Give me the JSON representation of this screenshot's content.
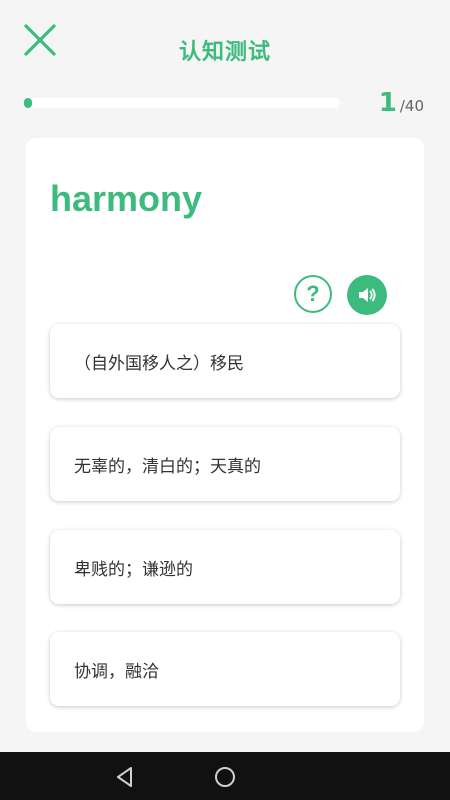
{
  "header": {
    "title": "认知测试",
    "close_icon": "close-icon"
  },
  "progress": {
    "current": "1",
    "total": "/40",
    "fraction": 0.025
  },
  "question": {
    "word": "harmony",
    "help_label": "?",
    "help_icon": "question-icon",
    "sound_icon": "speaker-icon"
  },
  "options": [
    {
      "text": "（自外国移人之）移民"
    },
    {
      "text": "无辜的，清白的；天真的"
    },
    {
      "text": "卑贱的；谦逊的"
    },
    {
      "text": "协调，融洽"
    }
  ],
  "nav": {
    "back_icon": "back-triangle-icon",
    "home_icon": "home-circle-icon"
  },
  "colors": {
    "accent": "#3dbb7f",
    "background": "#f5f5f5",
    "card": "#ffffff",
    "navbar": "#111111"
  }
}
